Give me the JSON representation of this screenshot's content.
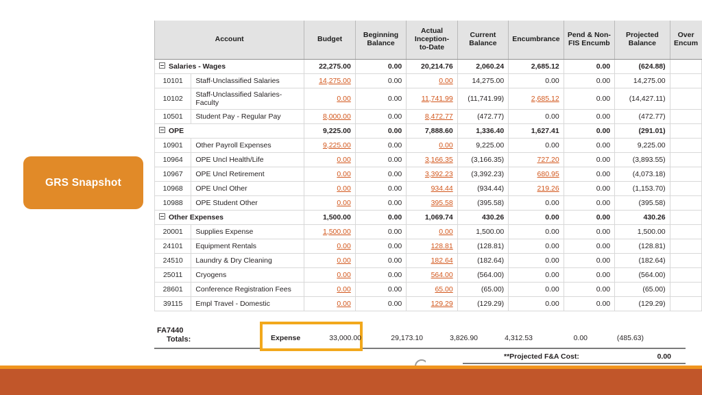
{
  "callout": {
    "label": "GRS Snapshot"
  },
  "table": {
    "headers": {
      "account": "Account",
      "budget": "Budget",
      "beginning_balance": "Beginning Balance",
      "actual_itd": "Actual Inception-to-Date",
      "current_balance": "Current Balance",
      "encumbrance": "Encumbrance",
      "pend_non_fis": "Pend & Non-FIS Encumb",
      "projected_balance": "Projected Balance",
      "over_encum": "Over Encum"
    },
    "groups": [
      {
        "name": "Salaries - Wages",
        "totals": {
          "budget": "22,275.00",
          "beginning_balance": "0.00",
          "actual_itd": "20,214.76",
          "current_balance": "2,060.24",
          "encumbrance": "2,685.12",
          "pend_non_fis": "0.00",
          "projected_balance": "(624.88)",
          "over_encum": ""
        },
        "rows": [
          {
            "code": "10101",
            "name": "Staff-Unclassified Salaries",
            "budget": "14,275.00",
            "budget_link": true,
            "beginning_balance": "0.00",
            "beginning_link": false,
            "actual_itd": "0.00",
            "actual_link": true,
            "current_balance": "14,275.00",
            "encumbrance": "0.00",
            "encumbrance_link": false,
            "pend_non_fis": "0.00",
            "projected_balance": "14,275.00",
            "over_encum": ""
          },
          {
            "code": "10102",
            "name": "Staff-Unclassified Salaries-Faculty",
            "budget": "0.00",
            "budget_link": true,
            "beginning_balance": "0.00",
            "beginning_link": false,
            "actual_itd": "11,741.99",
            "actual_link": true,
            "current_balance": "(11,741.99)",
            "encumbrance": "2,685.12",
            "encumbrance_link": true,
            "pend_non_fis": "0.00",
            "projected_balance": "(14,427.11)",
            "over_encum": ""
          },
          {
            "code": "10501",
            "name": "Student Pay - Regular Pay",
            "budget": "8,000.00",
            "budget_link": true,
            "beginning_balance": "0.00",
            "beginning_link": false,
            "actual_itd": "8,472.77",
            "actual_link": true,
            "current_balance": "(472.77)",
            "encumbrance": "0.00",
            "encumbrance_link": false,
            "pend_non_fis": "0.00",
            "projected_balance": "(472.77)",
            "over_encum": ""
          }
        ]
      },
      {
        "name": "OPE",
        "totals": {
          "budget": "9,225.00",
          "beginning_balance": "0.00",
          "actual_itd": "7,888.60",
          "current_balance": "1,336.40",
          "encumbrance": "1,627.41",
          "pend_non_fis": "0.00",
          "projected_balance": "(291.01)",
          "over_encum": ""
        },
        "rows": [
          {
            "code": "10901",
            "name": "Other Payroll Expenses",
            "budget": "9,225.00",
            "budget_link": true,
            "beginning_balance": "0.00",
            "beginning_link": false,
            "actual_itd": "0.00",
            "actual_link": true,
            "current_balance": "9,225.00",
            "encumbrance": "0.00",
            "encumbrance_link": false,
            "pend_non_fis": "0.00",
            "projected_balance": "9,225.00",
            "over_encum": ""
          },
          {
            "code": "10964",
            "name": "OPE Uncl Health/Life",
            "budget": "0.00",
            "budget_link": true,
            "beginning_balance": "0.00",
            "beginning_link": false,
            "actual_itd": "3,166.35",
            "actual_link": true,
            "current_balance": "(3,166.35)",
            "encumbrance": "727.20",
            "encumbrance_link": true,
            "pend_non_fis": "0.00",
            "projected_balance": "(3,893.55)",
            "over_encum": ""
          },
          {
            "code": "10967",
            "name": "OPE Uncl Retirement",
            "budget": "0.00",
            "budget_link": true,
            "beginning_balance": "0.00",
            "beginning_link": false,
            "actual_itd": "3,392.23",
            "actual_link": true,
            "current_balance": "(3,392.23)",
            "encumbrance": "680.95",
            "encumbrance_link": true,
            "pend_non_fis": "0.00",
            "projected_balance": "(4,073.18)",
            "over_encum": ""
          },
          {
            "code": "10968",
            "name": "OPE Uncl Other",
            "budget": "0.00",
            "budget_link": true,
            "beginning_balance": "0.00",
            "beginning_link": false,
            "actual_itd": "934.44",
            "actual_link": true,
            "current_balance": "(934.44)",
            "encumbrance": "219.26",
            "encumbrance_link": true,
            "pend_non_fis": "0.00",
            "projected_balance": "(1,153.70)",
            "over_encum": ""
          },
          {
            "code": "10988",
            "name": "OPE Student Other",
            "budget": "0.00",
            "budget_link": true,
            "beginning_balance": "0.00",
            "beginning_link": false,
            "actual_itd": "395.58",
            "actual_link": true,
            "current_balance": "(395.58)",
            "encumbrance": "0.00",
            "encumbrance_link": false,
            "pend_non_fis": "0.00",
            "projected_balance": "(395.58)",
            "over_encum": ""
          }
        ]
      },
      {
        "name": "Other Expenses",
        "totals": {
          "budget": "1,500.00",
          "beginning_balance": "0.00",
          "actual_itd": "1,069.74",
          "current_balance": "430.26",
          "encumbrance": "0.00",
          "pend_non_fis": "0.00",
          "projected_balance": "430.26",
          "over_encum": ""
        },
        "rows": [
          {
            "code": "20001",
            "name": "Supplies Expense",
            "budget": "1,500.00",
            "budget_link": true,
            "beginning_balance": "0.00",
            "beginning_link": false,
            "actual_itd": "0.00",
            "actual_link": true,
            "current_balance": "1,500.00",
            "encumbrance": "0.00",
            "encumbrance_link": false,
            "pend_non_fis": "0.00",
            "projected_balance": "1,500.00",
            "over_encum": ""
          },
          {
            "code": "24101",
            "name": "Equipment Rentals",
            "budget": "0.00",
            "budget_link": true,
            "beginning_balance": "0.00",
            "beginning_link": false,
            "actual_itd": "128.81",
            "actual_link": true,
            "current_balance": "(128.81)",
            "encumbrance": "0.00",
            "encumbrance_link": false,
            "pend_non_fis": "0.00",
            "projected_balance": "(128.81)",
            "over_encum": ""
          },
          {
            "code": "24510",
            "name": "Laundry & Dry Cleaning",
            "budget": "0.00",
            "budget_link": true,
            "beginning_balance": "0.00",
            "beginning_link": false,
            "actual_itd": "182.64",
            "actual_link": true,
            "current_balance": "(182.64)",
            "encumbrance": "0.00",
            "encumbrance_link": false,
            "pend_non_fis": "0.00",
            "projected_balance": "(182.64)",
            "over_encum": ""
          },
          {
            "code": "25011",
            "name": "Cryogens",
            "budget": "0.00",
            "budget_link": true,
            "beginning_balance": "0.00",
            "beginning_link": false,
            "actual_itd": "564.00",
            "actual_link": true,
            "current_balance": "(564.00)",
            "encumbrance": "0.00",
            "encumbrance_link": false,
            "pend_non_fis": "0.00",
            "projected_balance": "(564.00)",
            "over_encum": ""
          },
          {
            "code": "28601",
            "name": "Conference Registration Fees",
            "budget": "0.00",
            "budget_link": true,
            "beginning_balance": "0.00",
            "beginning_link": false,
            "actual_itd": "65.00",
            "actual_link": true,
            "current_balance": "(65.00)",
            "encumbrance": "0.00",
            "encumbrance_link": false,
            "pend_non_fis": "0.00",
            "projected_balance": "(65.00)",
            "over_encum": ""
          },
          {
            "code": "39115",
            "name": "Empl Travel - Domestic",
            "budget": "0.00",
            "budget_link": true,
            "beginning_balance": "0.00",
            "beginning_link": false,
            "actual_itd": "129.29",
            "actual_link": true,
            "current_balance": "(129.29)",
            "encumbrance": "0.00",
            "encumbrance_link": false,
            "pend_non_fis": "0.00",
            "projected_balance": "(129.29)",
            "over_encum": ""
          }
        ]
      }
    ]
  },
  "totals": {
    "index_code": "FA7440",
    "totals_label": "Totals:",
    "expense_label": "Expense",
    "expense_value": "33,000.00",
    "actual_itd": "29,173.10",
    "current_balance": "3,826.90",
    "encumbrance": "4,312.53",
    "pend_non_fis": "0.00",
    "projected_balance": "(485.63)",
    "projected_fa_label": "**Projected F&A Cost:",
    "projected_fa_value": "0.00"
  },
  "colors": {
    "accent_orange": "#E18A28",
    "highlight_border": "#F2A81C",
    "bottom_bar": "#C1562A",
    "bottom_rule": "#F0941E",
    "group_row": "#FBE7CD",
    "link": "#D2561B"
  }
}
